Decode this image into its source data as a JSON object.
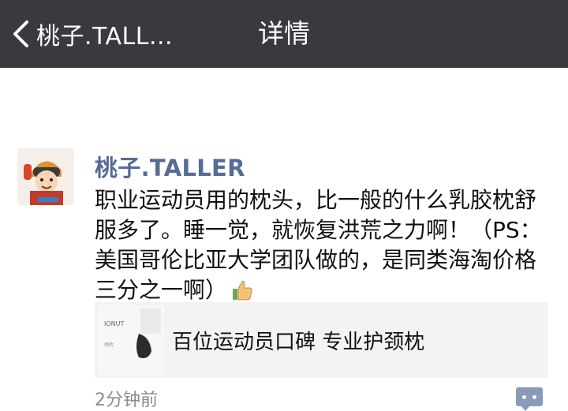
{
  "navbar": {
    "back_label": "桃子.TALL...",
    "title": "详情"
  },
  "post": {
    "author": "桃子.TALLER",
    "text": "职业运动员用的枕头，比一般的什么乳胶枕舒服多了。睡一觉，就恢复洪荒之力啊！（PS：美国哥伦比亚大学团队做的，是同类海淘价格三分之一啊）",
    "emoji_icon": "thumbs-up-icon",
    "card": {
      "title": "百位运动员口碑 专业护颈枕",
      "thumb_brand": "IONUT",
      "thumb_sub": "颈枕"
    },
    "time": "2分钟前",
    "comment_icon": "comment-icon"
  },
  "colors": {
    "navbar_bg": "#393a3f",
    "author": "#576b95",
    "card_bg": "#f3f3f5",
    "comment_btn": "#8a9ab8"
  }
}
